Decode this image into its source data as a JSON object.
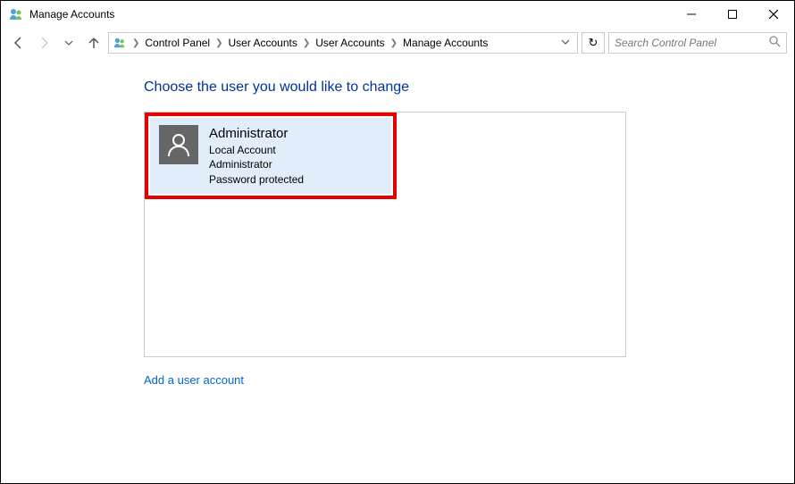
{
  "window": {
    "title": "Manage Accounts"
  },
  "breadcrumb": {
    "items": [
      "Control Panel",
      "User Accounts",
      "User Accounts",
      "Manage Accounts"
    ]
  },
  "search": {
    "placeholder": "Search Control Panel"
  },
  "page": {
    "heading": "Choose the user you would like to change",
    "add_link": "Add a user account"
  },
  "account": {
    "name": "Administrator",
    "type": "Local Account",
    "role": "Administrator",
    "protection": "Password protected"
  }
}
